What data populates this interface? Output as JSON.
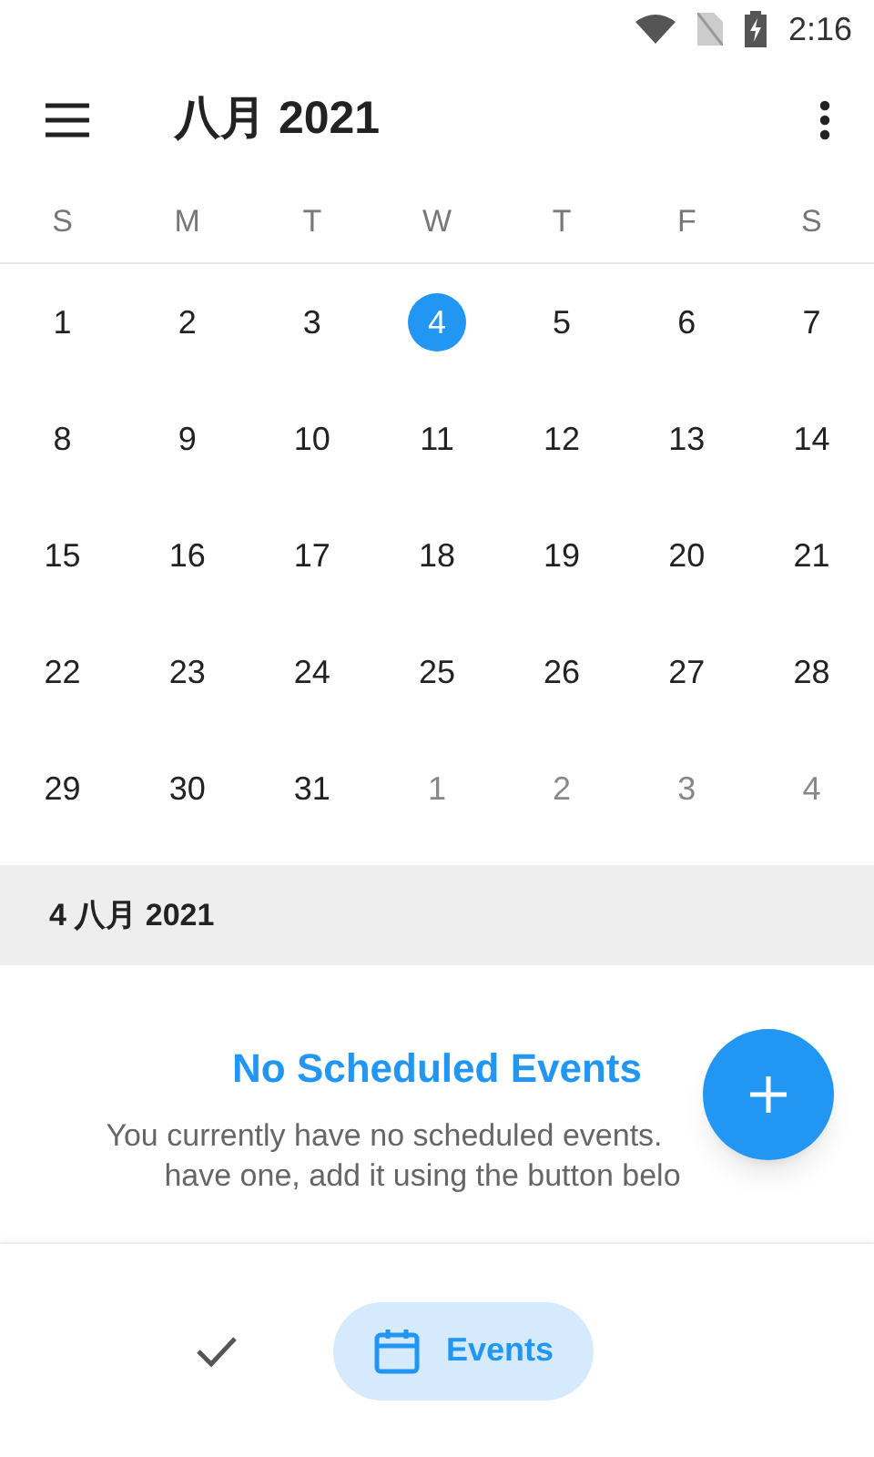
{
  "status_bar": {
    "time": "2:16"
  },
  "toolbar": {
    "title": "八月 2021"
  },
  "weekdays": [
    "S",
    "M",
    "T",
    "W",
    "T",
    "F",
    "S"
  ],
  "weeks": [
    [
      {
        "label": "1",
        "selected": false,
        "other_month": false
      },
      {
        "label": "2",
        "selected": false,
        "other_month": false
      },
      {
        "label": "3",
        "selected": false,
        "other_month": false
      },
      {
        "label": "4",
        "selected": true,
        "other_month": false
      },
      {
        "label": "5",
        "selected": false,
        "other_month": false
      },
      {
        "label": "6",
        "selected": false,
        "other_month": false
      },
      {
        "label": "7",
        "selected": false,
        "other_month": false
      }
    ],
    [
      {
        "label": "8",
        "selected": false,
        "other_month": false
      },
      {
        "label": "9",
        "selected": false,
        "other_month": false
      },
      {
        "label": "10",
        "selected": false,
        "other_month": false
      },
      {
        "label": "11",
        "selected": false,
        "other_month": false
      },
      {
        "label": "12",
        "selected": false,
        "other_month": false
      },
      {
        "label": "13",
        "selected": false,
        "other_month": false
      },
      {
        "label": "14",
        "selected": false,
        "other_month": false
      }
    ],
    [
      {
        "label": "15",
        "selected": false,
        "other_month": false
      },
      {
        "label": "16",
        "selected": false,
        "other_month": false
      },
      {
        "label": "17",
        "selected": false,
        "other_month": false
      },
      {
        "label": "18",
        "selected": false,
        "other_month": false
      },
      {
        "label": "19",
        "selected": false,
        "other_month": false
      },
      {
        "label": "20",
        "selected": false,
        "other_month": false
      },
      {
        "label": "21",
        "selected": false,
        "other_month": false
      }
    ],
    [
      {
        "label": "22",
        "selected": false,
        "other_month": false
      },
      {
        "label": "23",
        "selected": false,
        "other_month": false
      },
      {
        "label": "24",
        "selected": false,
        "other_month": false
      },
      {
        "label": "25",
        "selected": false,
        "other_month": false
      },
      {
        "label": "26",
        "selected": false,
        "other_month": false
      },
      {
        "label": "27",
        "selected": false,
        "other_month": false
      },
      {
        "label": "28",
        "selected": false,
        "other_month": false
      }
    ],
    [
      {
        "label": "29",
        "selected": false,
        "other_month": false
      },
      {
        "label": "30",
        "selected": false,
        "other_month": false
      },
      {
        "label": "31",
        "selected": false,
        "other_month": false
      },
      {
        "label": "1",
        "selected": false,
        "other_month": true
      },
      {
        "label": "2",
        "selected": false,
        "other_month": true
      },
      {
        "label": "3",
        "selected": false,
        "other_month": true
      },
      {
        "label": "4",
        "selected": false,
        "other_month": true
      }
    ]
  ],
  "date_header": "4 八月 2021",
  "empty_state": {
    "title": "No Scheduled Events",
    "lines": [
      "You currently have no scheduled events.",
      "have one, add it using the button belo"
    ]
  },
  "bottom_nav": [
    {
      "kind": "check",
      "selected": false
    },
    {
      "kind": "calendar",
      "label": "Events",
      "selected": true
    }
  ]
}
